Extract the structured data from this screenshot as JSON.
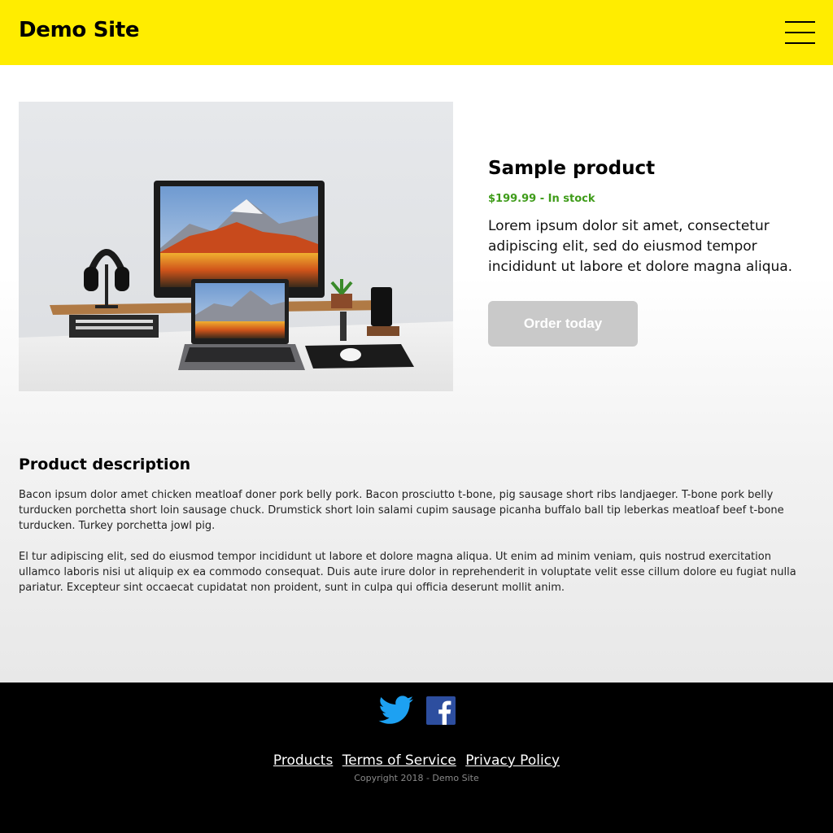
{
  "header": {
    "brand": "Demo Site",
    "menu_icon": "hamburger-menu-icon",
    "background_color": "#ffed00"
  },
  "product": {
    "image_alt": "Desk setup with monitor, laptop, headphones and plant",
    "title": "Sample product",
    "price_stock": "$199.99 - In stock",
    "lead": "Lorem ipsum dolor sit amet, consectetur adipiscing elit, sed do eiusmod tempor incididunt ut labore et dolore magna aliqua.",
    "order_label": "Order today",
    "price_color": "#3f9c1a"
  },
  "description": {
    "heading": "Product description",
    "paragraphs": [
      "Bacon ipsum dolor amet chicken meatloaf doner pork belly pork. Bacon prosciutto t-bone, pig sausage short ribs landjaeger. T-bone pork belly turducken porchetta short loin sausage chuck. Drumstick short loin salami cupim sausage picanha buffalo ball tip leberkas meatloaf beef t-bone turducken. Turkey porchetta jowl pig.",
      "El tur adipiscing elit, sed do eiusmod tempor incididunt ut labore et dolore magna aliqua. Ut enim ad minim veniam, quis nostrud exercitation ullamco laboris nisi ut aliquip ex ea commodo consequat. Duis aute irure dolor in reprehenderit in voluptate velit esse cillum dolore eu fugiat nulla pariatur. Excepteur sint occaecat cupidatat non proident, sunt in culpa qui officia deserunt mollit anim."
    ]
  },
  "footer": {
    "social": [
      {
        "name": "Twitter",
        "icon": "twitter-icon"
      },
      {
        "name": "Facebook",
        "icon": "facebook-icon"
      }
    ],
    "links": [
      "Products",
      "Terms of Service",
      "Privacy Policy"
    ],
    "copyright": "Copyright 2018 - Demo Site"
  }
}
